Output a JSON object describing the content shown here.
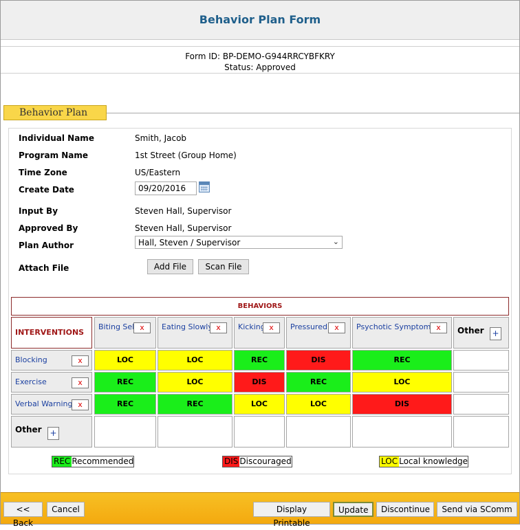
{
  "header": {
    "title": "Behavior Plan Form"
  },
  "form_meta": {
    "form_id": "Form ID: BP-DEMO-G944RRCYBFKRY",
    "status": "Status: Approved"
  },
  "section": {
    "title": "Behavior Plan"
  },
  "fields": {
    "individual_name": {
      "label": "Individual Name",
      "value": "Smith, Jacob"
    },
    "program_name": {
      "label": "Program Name",
      "value": "1st Street (Group Home)"
    },
    "time_zone": {
      "label": "Time Zone",
      "value": "US/Eastern"
    },
    "create_date": {
      "label": "Create Date",
      "value": "09/20/2016"
    },
    "input_by": {
      "label": "Input By",
      "value": "Steven Hall, Supervisor"
    },
    "approved_by": {
      "label": "Approved By",
      "value": "Steven Hall, Supervisor"
    },
    "plan_author": {
      "label": "Plan Author",
      "value": "Hall, Steven / Supervisor"
    },
    "attach_file": {
      "label": "Attach File",
      "add_label": "Add File",
      "scan_label": "Scan File"
    }
  },
  "matrix": {
    "behaviors_title": "BEHAVIORS",
    "interventions_title": "INTERVENTIONS",
    "remove_label": "x",
    "add_label": "+",
    "other_label": "Other",
    "behaviors": [
      "Biting Self",
      "Eating Slowly",
      "Kicking",
      "Pressured",
      "Psychotic Symptoms"
    ],
    "rows": [
      {
        "name": "Blocking",
        "cells": [
          "LOC",
          "LOC",
          "REC",
          "DIS",
          "REC"
        ]
      },
      {
        "name": "Exercise",
        "cells": [
          "REC",
          "LOC",
          "DIS",
          "REC",
          "LOC"
        ]
      },
      {
        "name": "Verbal Warning",
        "cells": [
          "REC",
          "REC",
          "LOC",
          "LOC",
          "DIS"
        ]
      }
    ],
    "colors": {
      "REC": "#1aee1a",
      "LOC": "#ffff00",
      "DIS": "#ff1a1a"
    }
  },
  "legend": [
    {
      "code": "REC",
      "label": "Recommended"
    },
    {
      "code": "DIS",
      "label": "Discouraged"
    },
    {
      "code": "LOC",
      "label": "Local knowledge"
    }
  ],
  "footer": {
    "back": "<< Back",
    "cancel": "Cancel",
    "display_printable": "Display Printable",
    "update": "Update",
    "discontinue": "Discontinue",
    "send": "Send via SComm"
  }
}
